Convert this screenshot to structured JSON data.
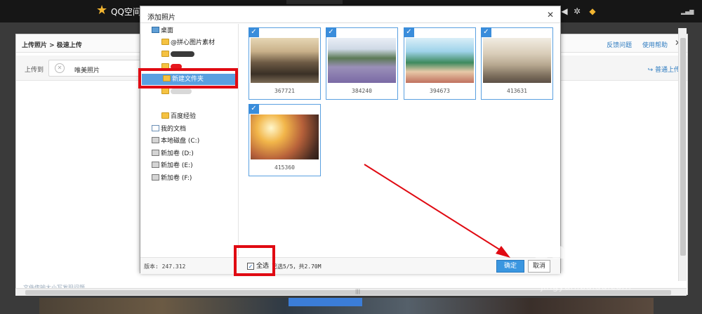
{
  "topbar": {
    "logo_text": "QQ空间"
  },
  "background_window": {
    "breadcrumb": "上传照片 > 极速上传",
    "links": [
      "反馈问题",
      "使用帮助"
    ],
    "close": "✕",
    "upload_to_label": "上传到",
    "album_name": "唯美照片",
    "normal_upload": "普通上传",
    "bottom_link": "文件传输大小写发现问题"
  },
  "dialog": {
    "title": "添加照片",
    "close": "✕",
    "tree": [
      {
        "label": "桌面",
        "icon": "desktop-icon",
        "kind": "desktop"
      },
      {
        "label": "@拼心图片素材",
        "icon": "folder-icon",
        "kind": "folder"
      },
      {
        "label": "",
        "icon": "folder-icon",
        "kind": "folder",
        "obscured": true
      },
      {
        "label": "",
        "icon": "folder-icon",
        "kind": "folder",
        "obscured": true
      },
      {
        "label": "新建文件夹",
        "icon": "folder-icon",
        "kind": "folder",
        "selected": true
      },
      {
        "label": "",
        "icon": "folder-icon",
        "kind": "folder",
        "obscured": true
      },
      {
        "label": "百度经验",
        "icon": "folder-icon",
        "kind": "folder"
      },
      {
        "label": "我的文档",
        "icon": "document-icon",
        "kind": "doc"
      },
      {
        "label": "本地磁盘 (C:)",
        "icon": "drive-icon",
        "kind": "drive"
      },
      {
        "label": "新加卷 (D:)",
        "icon": "drive-icon",
        "kind": "drive"
      },
      {
        "label": "新加卷 (E:)",
        "icon": "drive-icon",
        "kind": "drive"
      },
      {
        "label": "新加卷 (F:)",
        "icon": "drive-icon",
        "kind": "drive"
      }
    ],
    "photos": [
      {
        "name": "367721",
        "checked": true
      },
      {
        "name": "384240",
        "checked": true
      },
      {
        "name": "394673",
        "checked": true
      },
      {
        "name": "413631",
        "checked": true
      },
      {
        "name": "415360",
        "checked": true
      }
    ],
    "footer": {
      "version": "版本: 247.312",
      "select_all": "全选",
      "summary": "已选5/5，共2.70M",
      "ok": "确定",
      "cancel": "取消"
    }
  },
  "watermark": {
    "text": "Bai 经验",
    "url": "jingyan.baidu.com"
  },
  "colors": {
    "accent": "#3a96e0",
    "selection": "#5aa0e0",
    "annotation": "#e00a12",
    "topbar": "#161616"
  }
}
